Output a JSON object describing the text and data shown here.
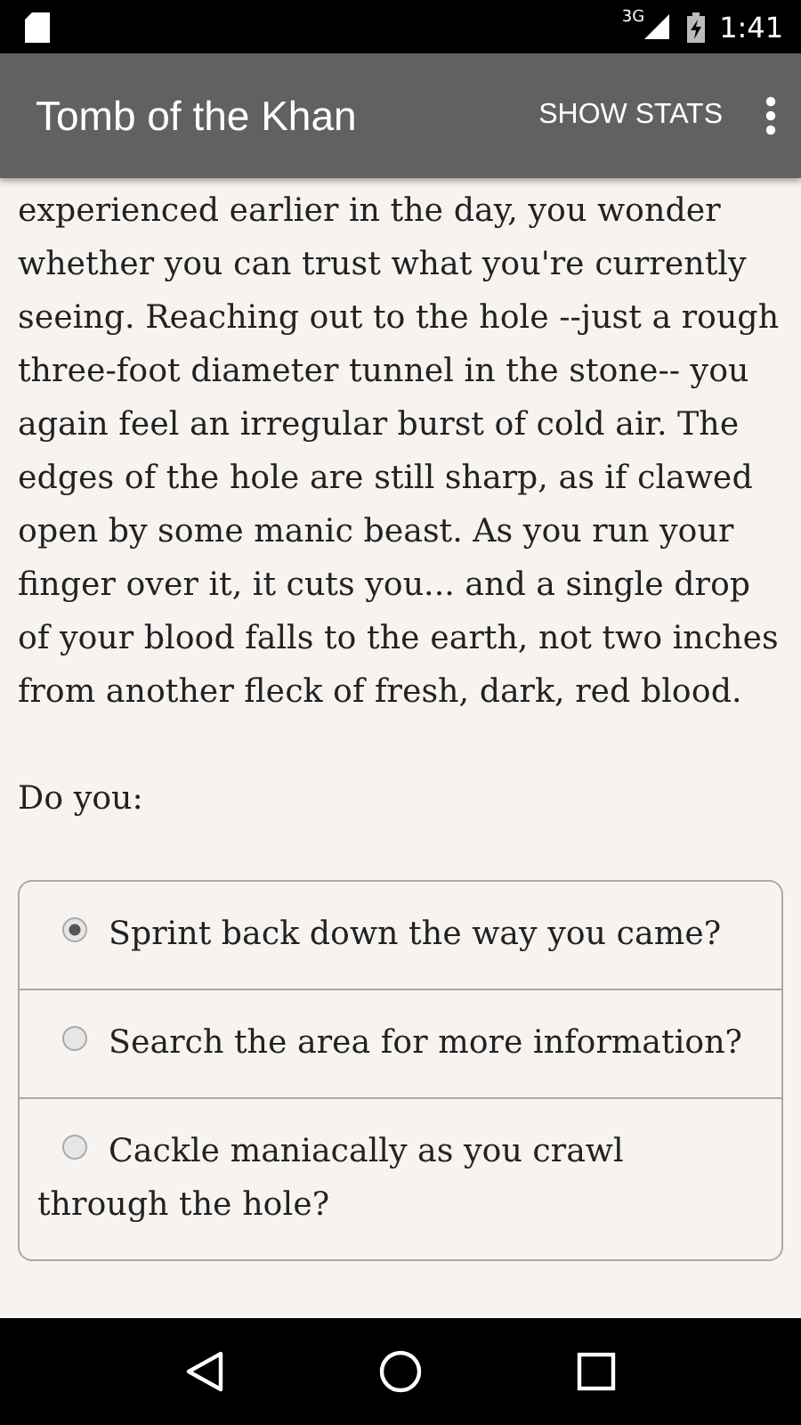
{
  "status_bar": {
    "network": "3G",
    "time": "1:41"
  },
  "app_bar": {
    "title": "Tomb of the Khan",
    "action": "SHOW STATS"
  },
  "story": "experienced earlier in the day, you wonder whether you can trust what you're currently seeing. Reaching out to the hole --just a rough three-foot diameter tunnel in the stone-- you again feel an irregular burst of cold air. The edges of the hole are still sharp, as if clawed open by some manic beast. As you run your finger over it, it cuts you... and a single drop of your blood falls to the earth, not two inches from another fleck of fresh, dark, red blood.",
  "prompt": "Do you:",
  "choices": [
    {
      "label": "Sprint back down the way you came?",
      "selected": true
    },
    {
      "label": "Search the area for more information?",
      "selected": false
    },
    {
      "label": "Cackle maniacally as you crawl through the hole?",
      "selected": false
    }
  ]
}
